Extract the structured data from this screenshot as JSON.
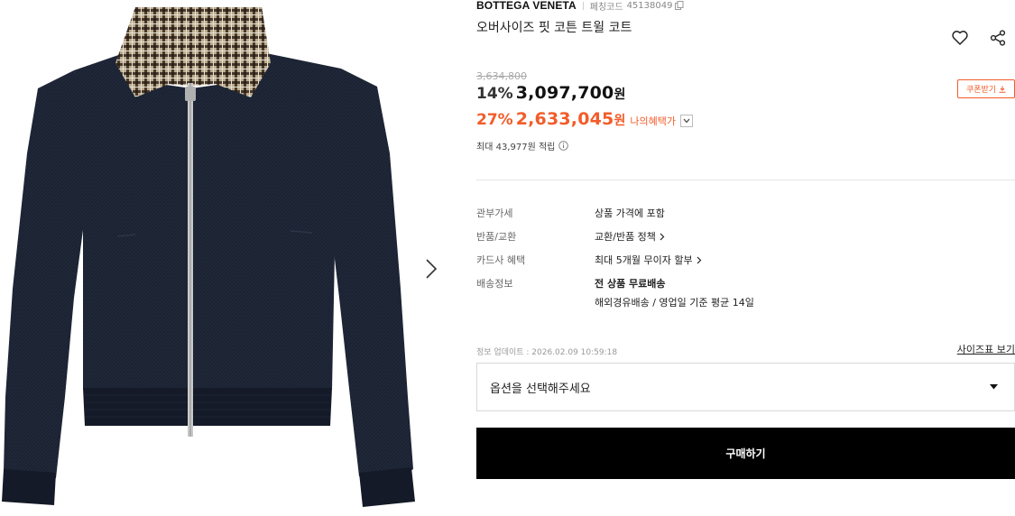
{
  "product": {
    "brand": "BOTTEGA VENETA",
    "code_label": "페칭코드",
    "code_value": "45138049",
    "title": "오버사이즈 핏 코튼 트윌 코트",
    "original_price": "3,634,800",
    "sale": {
      "rate": "14%",
      "amount": "3,097,700",
      "unit": "원"
    },
    "benefit": {
      "rate": "27%",
      "amount": "2,633,045",
      "unit": "원",
      "label": "나의혜택가"
    },
    "points": "최대 43,977원 적립",
    "coupon_label": "쿠폰받기"
  },
  "specs": [
    {
      "label": "관부가세",
      "value": "상품 가격에 포함"
    },
    {
      "label": "반품/교환",
      "value": "교환/반품 정책"
    },
    {
      "label": "카드사 혜택",
      "value": "최대 5개월 무이자 할부"
    },
    {
      "label": "배송정보",
      "value": "전 상품 무료배송",
      "value2": "해외경유배송 / 영업일 기준 평균 14일"
    }
  ],
  "updated": "정보 업데이트 : 2026.02.09 10:59:18",
  "size_guide": "사이즈표 보기",
  "option_placeholder": "옵션을 선택해주세요",
  "buy_label": "구매하기",
  "colors": {
    "accent": "#f25c29",
    "jacket": "#1b2232",
    "buy_button": "#000000"
  },
  "icons": [
    "copy-icon",
    "heart-icon",
    "share-icon",
    "download-icon",
    "chevron-down-icon",
    "info-icon",
    "chevron-right-icon",
    "caret-down-icon"
  ]
}
